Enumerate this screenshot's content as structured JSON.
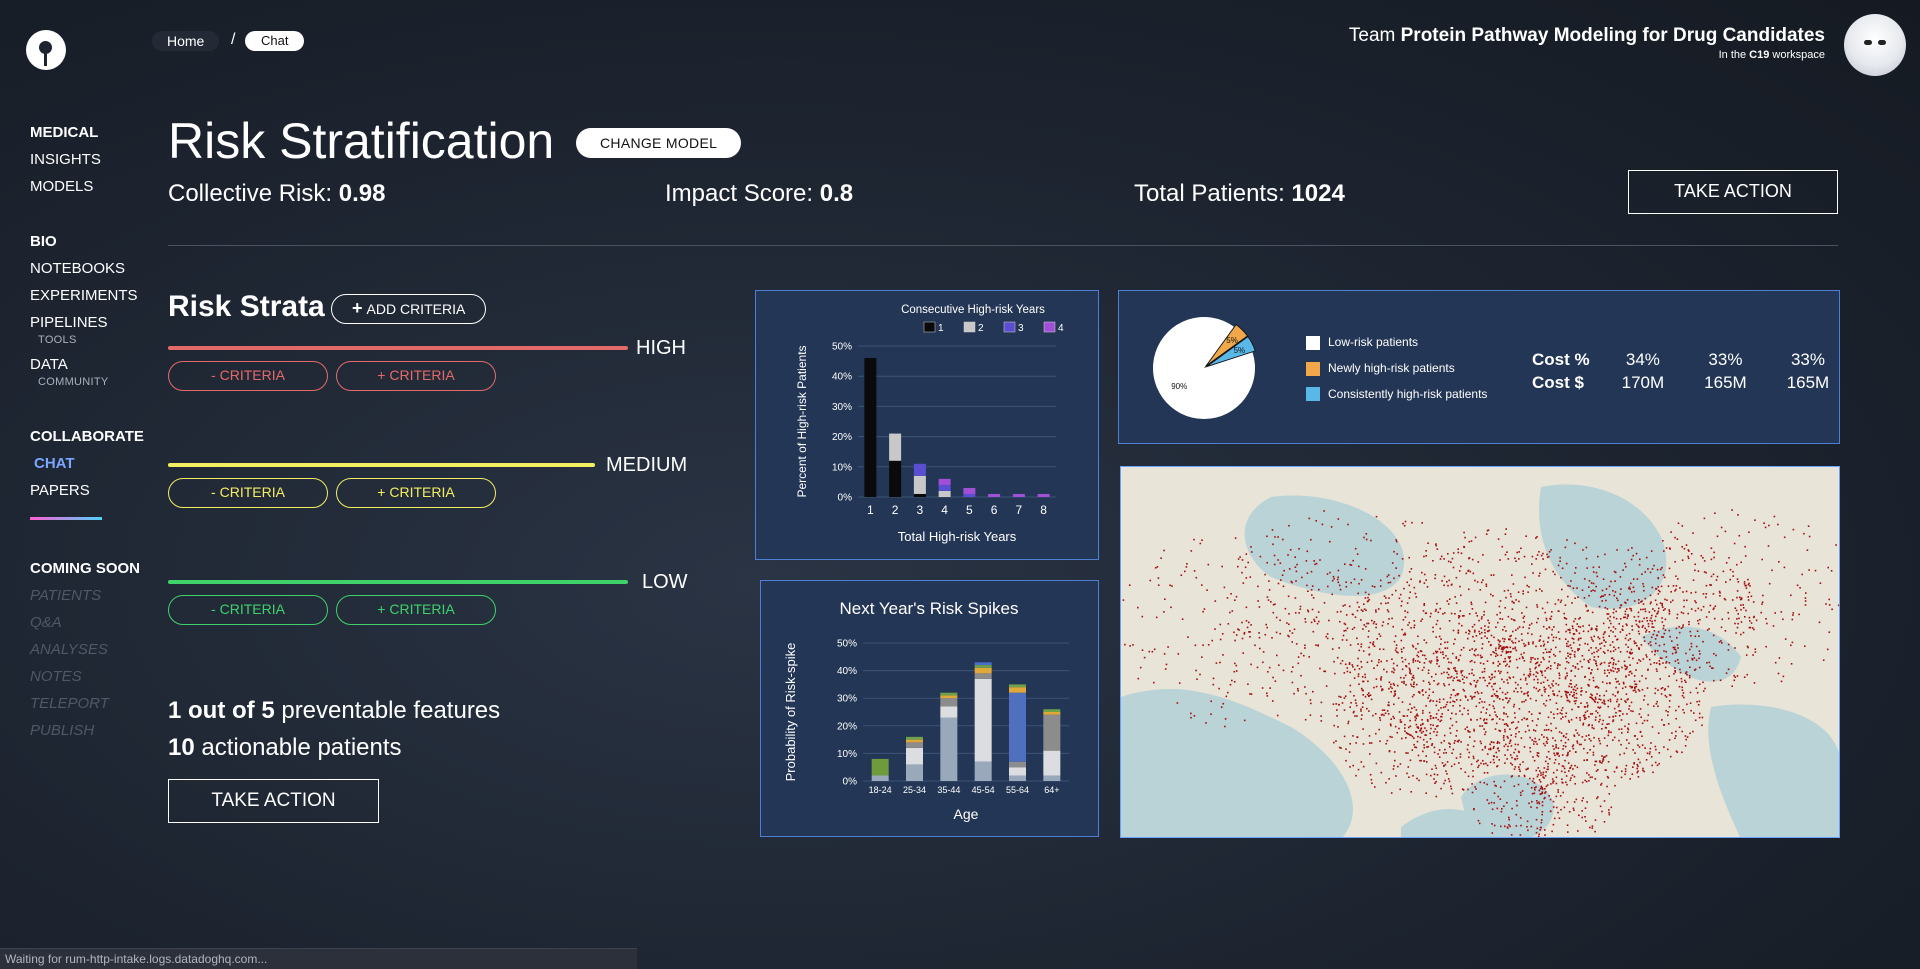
{
  "breadcrumb": {
    "home": "Home",
    "sep": "/",
    "current": "Chat"
  },
  "team": {
    "prefix": "Team ",
    "name": "Protein Pathway Modeling for Drug Candidates",
    "workspace_prefix": "In the ",
    "workspace": "C19",
    "workspace_suffix": " workspace"
  },
  "sidebar": {
    "medical": {
      "header": "MEDICAL",
      "items": [
        "INSIGHTS",
        "MODELS"
      ]
    },
    "bio": {
      "header": "BIO",
      "notebooks": "NOTEBOOKS",
      "experiments": "EXPERIMENTS",
      "pipelines": "PIPELINES",
      "tools": "TOOLS",
      "data": "DATA",
      "community": "COMMUNITY"
    },
    "collaborate": {
      "header": "COLLABORATE",
      "chat": "CHAT",
      "papers": "PAPERS"
    },
    "coming_soon": {
      "header": "COMING SOON",
      "items": [
        "PATIENTS",
        "Q&A",
        "ANALYSES",
        "NOTES",
        "TELEPORT",
        "PUBLISH"
      ]
    }
  },
  "header": {
    "title": "Risk Stratification",
    "change_model": "CHANGE MODEL",
    "collective_label": "Collective Risk: ",
    "collective_value": "0.98",
    "impact_label": "Impact Score: ",
    "impact_value": "0.8",
    "patients_label": "Total Patients: ",
    "patients_value": "1024",
    "take_action": "TAKE ACTION"
  },
  "strata": {
    "title": "Risk Strata",
    "add_criteria": "ADD CRITERIA",
    "levels": [
      {
        "label": "HIGH",
        "color": "#e46a6a",
        "minus": "- CRITERIA",
        "plus": "+ CRITERIA"
      },
      {
        "label": "MEDIUM",
        "color": "#f4ee62",
        "minus": "- CRITERIA",
        "plus": "+ CRITERIA"
      },
      {
        "label": "LOW",
        "color": "#3fd26a",
        "minus": "- CRITERIA",
        "plus": "+ CRITERIA"
      }
    ]
  },
  "summary": {
    "features_count": "1 out of 5",
    "features_text": " preventable features",
    "patients_count": "10",
    "patients_text": " actionable patients",
    "take_action": "TAKE ACTION"
  },
  "status_bar": "Waiting for rum-http-intake.logs.datadoghq.com...",
  "colors": {
    "panel_border": "#4d7fd4",
    "panel_bg": "#233655",
    "accent": "#7aa6ff"
  },
  "pie_legend": [
    {
      "label": "Low-risk patients",
      "color": "#ffffff"
    },
    {
      "label": "Newly high-risk patients",
      "color": "#f0a84a"
    },
    {
      "label": "Consistently high-risk patients",
      "color": "#5ab8e8"
    }
  ],
  "cost_table": {
    "rows": [
      {
        "label": "Cost %",
        "values": [
          "34%",
          "33%",
          "33%"
        ]
      },
      {
        "label": "Cost $",
        "values": [
          "170M",
          "165M",
          "165M"
        ]
      }
    ]
  },
  "chart_data": [
    {
      "type": "bar",
      "stacked": true,
      "legend_title": "Consecutive High-risk Years",
      "xlabel": "Total High-risk Years",
      "ylabel": "Percent of High-risk Patients",
      "ylim": [
        0,
        50
      ],
      "yticks": [
        "0%",
        "10%",
        "20%",
        "30%",
        "40%",
        "50%"
      ],
      "categories": [
        "1",
        "2",
        "3",
        "4",
        "5",
        "6",
        "7",
        "8"
      ],
      "series": [
        {
          "name": "1",
          "color": "#0a0a0a",
          "values": [
            46,
            12,
            1,
            0,
            0,
            0,
            0,
            0
          ]
        },
        {
          "name": "2",
          "color": "#c8c8c8",
          "values": [
            0,
            9,
            6,
            2,
            0,
            0,
            0,
            0
          ]
        },
        {
          "name": "3",
          "color": "#5a4fd0",
          "values": [
            0,
            0,
            4,
            2,
            1,
            0,
            0,
            0
          ]
        },
        {
          "name": "4",
          "color": "#a24fd8",
          "values": [
            0,
            0,
            0,
            2,
            2,
            1,
            1,
            1
          ]
        }
      ]
    },
    {
      "type": "bar",
      "stacked": true,
      "title": "Next Year's Risk Spikes",
      "xlabel": "Age",
      "ylabel": "Probability of Risk-spike",
      "ylim": [
        0,
        50
      ],
      "yticks": [
        "0%",
        "10%",
        "20%",
        "30%",
        "40%",
        "50%"
      ],
      "categories": [
        "18-24",
        "25-34",
        "35-44",
        "45-54",
        "55-64",
        "64+"
      ],
      "series": [
        {
          "color": "#9aa8bc",
          "values": [
            2,
            6,
            23,
            7,
            2,
            2
          ]
        },
        {
          "color": "#dcdde0",
          "values": [
            0,
            6,
            4,
            30,
            3,
            9
          ]
        },
        {
          "color": "#8c8c8c",
          "values": [
            0,
            2,
            3,
            2,
            2,
            13
          ]
        },
        {
          "color": "#6f9b3c",
          "values": [
            6,
            0,
            0,
            0,
            0,
            0
          ]
        },
        {
          "color": "#4f6fbf",
          "values": [
            0,
            0,
            0,
            0,
            25,
            0
          ]
        },
        {
          "color": "#e0a73a",
          "values": [
            0,
            1,
            1,
            2,
            2,
            1
          ]
        },
        {
          "color": "#6fa04a",
          "values": [
            0,
            1,
            1,
            1,
            1,
            1
          ]
        },
        {
          "color": "#4a6fc8",
          "values": [
            0,
            0,
            0,
            1,
            0,
            0
          ]
        }
      ]
    },
    {
      "type": "pie",
      "slices": [
        {
          "label": "90%",
          "value": 90,
          "color": "#ffffff"
        },
        {
          "label": "5%",
          "value": 5,
          "color": "#f0a84a"
        },
        {
          "label": "5%",
          "value": 5,
          "color": "#5ab8e8"
        }
      ]
    }
  ]
}
